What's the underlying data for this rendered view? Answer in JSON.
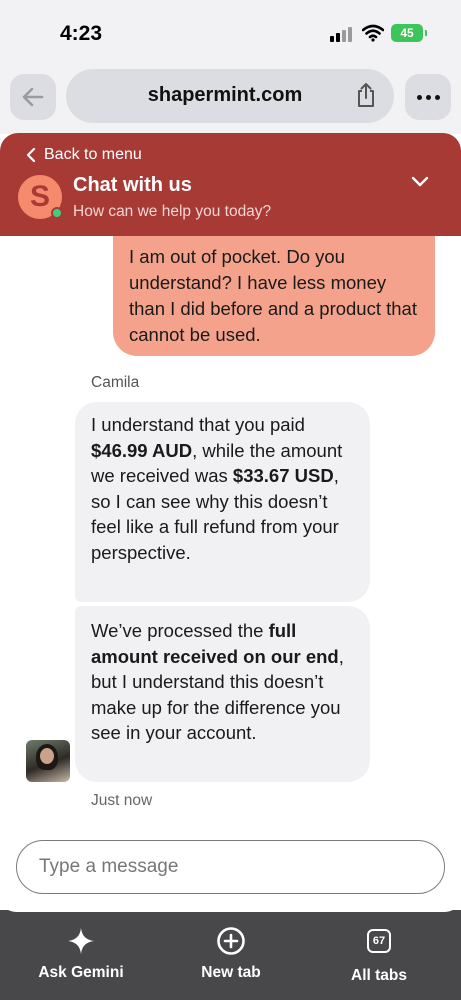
{
  "status_bar": {
    "time": "4:23",
    "battery": "45"
  },
  "browser": {
    "url": "shapermint.com"
  },
  "chat_header": {
    "back_label": "Back to menu",
    "logo_letter": "S",
    "title": "Chat with us",
    "subtitle": "How can we help you today?"
  },
  "messages": {
    "user": {
      "text": "I am out of pocket. Do you understand? I have less money than I did before and a product that cannot be used."
    },
    "agent_name": "Camila",
    "agent_1": {
      "part1": "I understand that you paid ",
      "bold1": "$46.99 AUD",
      "part2": ", while the amount we received was ",
      "bold2": "$33.67 USD",
      "part3": ", so I can see why this doesn’t feel like a full refund from your perspective."
    },
    "agent_2": {
      "part1": "We’ve processed the ",
      "bold1": "full amount received on our end",
      "part2": ", but I understand this doesn’t make up for the difference you see in your account."
    },
    "timestamp": "Just now"
  },
  "composer": {
    "placeholder": "Type a message"
  },
  "toolbar": {
    "ask_gemini": "Ask Gemini",
    "new_tab": "New tab",
    "all_tabs": "All tabs",
    "tab_count": "67"
  },
  "colors": {
    "header_bg": "#a83a36",
    "user_bubble": "#f4a28b",
    "agent_bubble": "#f1f1f3",
    "online": "#3fd07f"
  },
  "icons": [
    "back-arrow-icon",
    "share-icon",
    "more-icon",
    "chevron-left-icon",
    "chevron-down-icon",
    "sparkle-icon",
    "plus-circle-icon",
    "tabs-icon"
  ]
}
